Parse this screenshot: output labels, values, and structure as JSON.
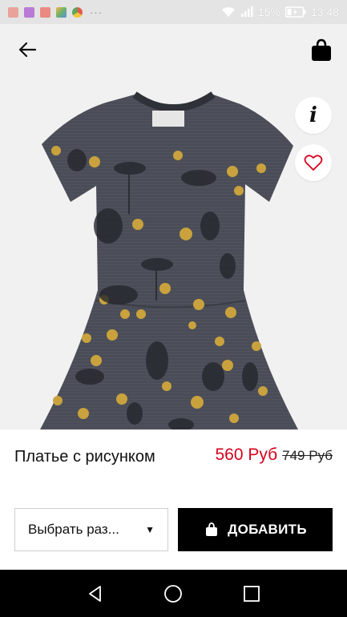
{
  "status_bar": {
    "notification_icons": [
      "email-icon",
      "image-icon",
      "gmail-icon",
      "photos-icon",
      "chrome-icon"
    ],
    "overflow": "···",
    "battery_percent": "15%",
    "time": "13:48"
  },
  "header": {
    "back_icon": "arrow-left-icon",
    "bag_icon": "shopping-bag-icon"
  },
  "image_actions": {
    "info_label": "i",
    "favorite_icon": "heart-icon"
  },
  "product": {
    "name": "Платье с рисунком",
    "price_current": "560 Руб",
    "price_old": "749 Руб"
  },
  "controls": {
    "size_select_label": "Выбрать раз...",
    "add_button_label": "ДОБАВИТЬ"
  },
  "colors": {
    "price_accent": "#d6001c",
    "button_bg": "#000000",
    "dress": "#4a4d57"
  },
  "navigation": {
    "back": "nav-back-icon",
    "home": "nav-home-icon",
    "recents": "nav-recents-icon"
  }
}
